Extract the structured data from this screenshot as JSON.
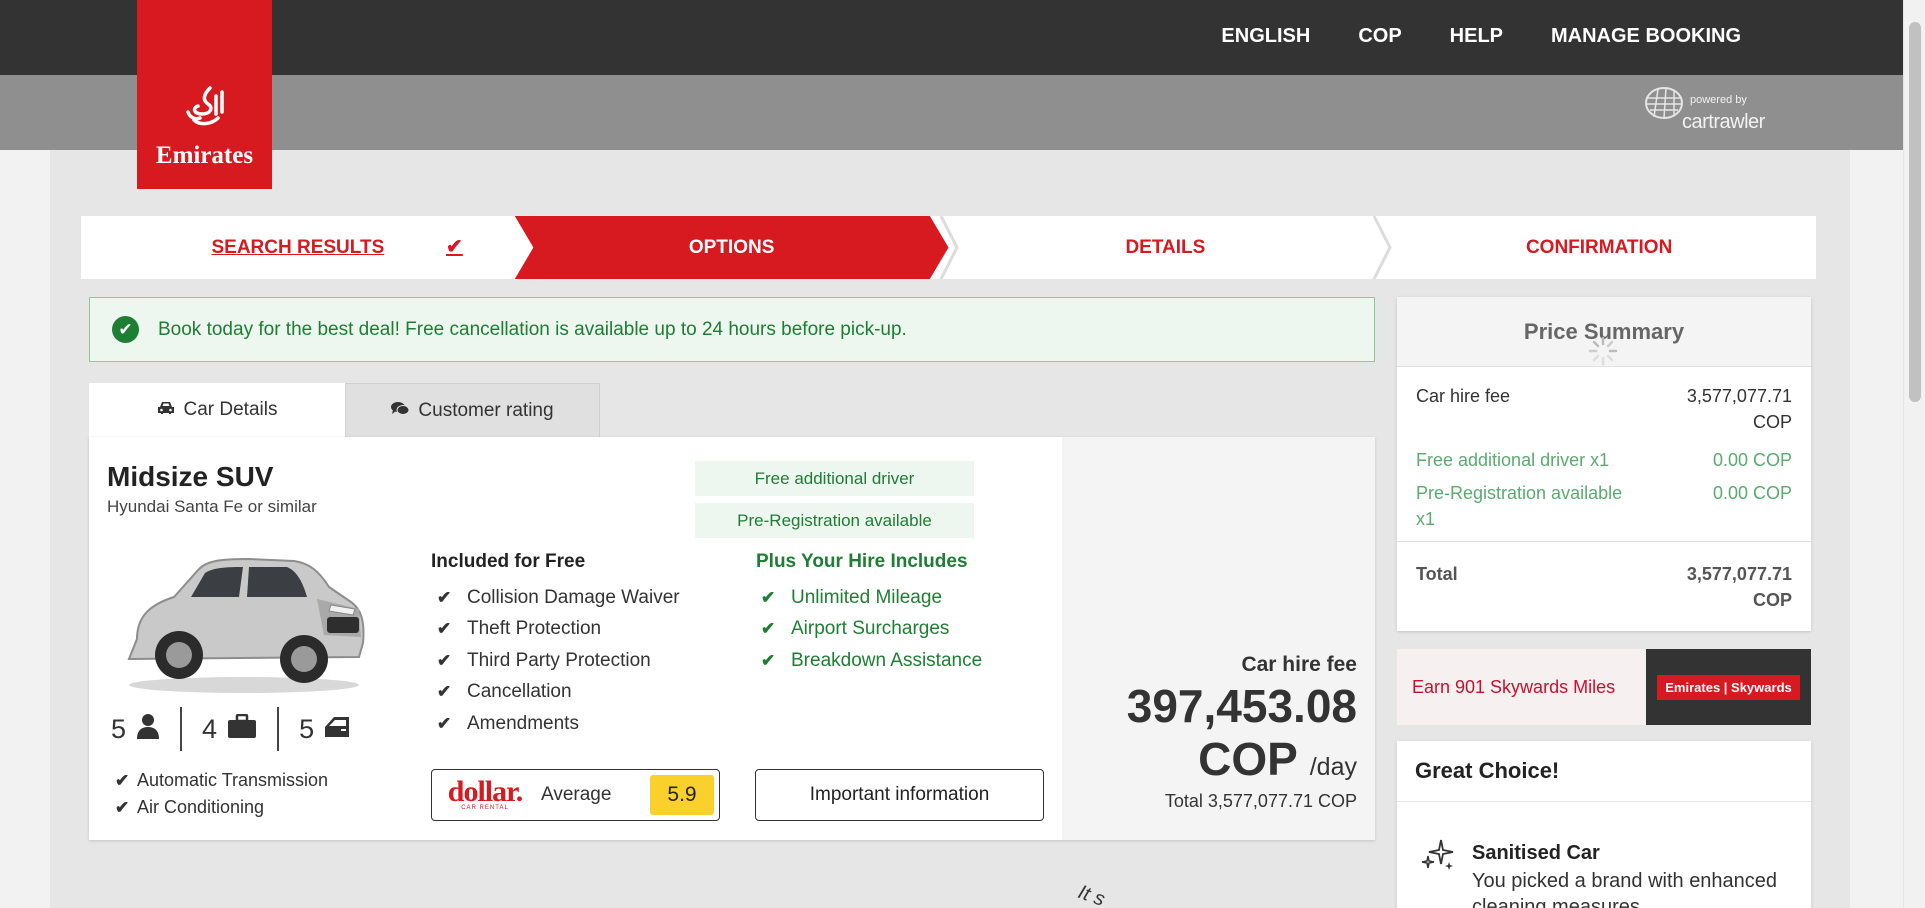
{
  "header": {
    "nav": [
      "ENGLISH",
      "COP",
      "HELP",
      "MANAGE BOOKING"
    ],
    "powered_small": "powered by",
    "powered_brand": "cartrawler",
    "logo_text": "Emirates",
    "logo_glyph": "ﻃﻤﺎﺭﺍﺕ"
  },
  "steps": [
    {
      "label": "SEARCH RESULTS"
    },
    {
      "label": "OPTIONS"
    },
    {
      "label": "DETAILS"
    },
    {
      "label": "CONFIRMATION"
    }
  ],
  "notice": "Book today for the best deal! Free cancellation is available up to 24 hours before pick-up.",
  "tabs": {
    "car_details": "Car Details",
    "customer_rating": "Customer rating"
  },
  "car": {
    "title": "Midsize SUV",
    "subtitle": "Hyundai Santa Fe or similar",
    "passengers": "5",
    "bags": "4",
    "doors": "5",
    "extras": [
      "Automatic Transmission",
      "Air Conditioning"
    ],
    "badges": [
      "Free additional driver",
      "Pre-Registration available"
    ],
    "included_heading": "Included for Free",
    "included": [
      "Collision Damage Waiver",
      "Theft Protection",
      "Third Party Protection",
      "Cancellation",
      "Amendments"
    ],
    "plus_heading": "Plus Your Hire Includes",
    "plus": [
      "Unlimited Mileage",
      "Airport Surcharges",
      "Breakdown Assistance"
    ],
    "supplier": {
      "logo": "dollar.",
      "logo_sub": "CAR RENTAL",
      "rating_word": "Average",
      "score": "5.9"
    },
    "info_button": "Important information",
    "price_label": "Car hire fee",
    "price_amount": "397,453.08",
    "price_currency": "COP",
    "price_unit": "/day",
    "price_total": "Total 3,577,077.71 COP"
  },
  "summary": {
    "title": "Price Summary",
    "rows": [
      {
        "label": "Car hire fee",
        "value": "3,577,077.71 COP"
      },
      {
        "label": "Free additional driver x1",
        "value": "0.00 COP"
      },
      {
        "label": "Pre-Registration available x1",
        "value": "0.00 COP"
      }
    ],
    "total_label": "Total",
    "total_value": "3,577,077.71 COP"
  },
  "skywards": {
    "text": "Earn 901 Skywards Miles",
    "badge": "Emirates | Skywards"
  },
  "great_choice": {
    "title": "Great Choice!",
    "item_title": "Sanitised Car",
    "item_text": "You picked a brand with enhanced cleaning measures"
  },
  "stray_text": "It s",
  "colors": {
    "brand_red": "#d71920",
    "green": "#1e7e34",
    "dark": "#333333",
    "rating_yellow": "#fad02c"
  }
}
